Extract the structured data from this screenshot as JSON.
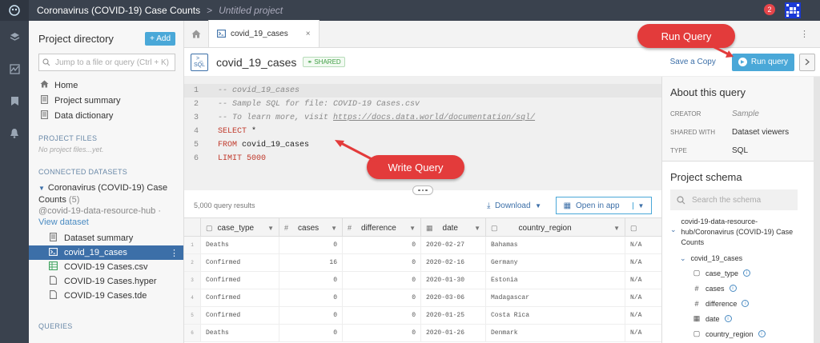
{
  "app": {
    "title": "Coronavirus (COVID-19) Case Counts",
    "separator": ">",
    "project_name": "Untitled project",
    "notification_count": "2"
  },
  "sidebar": {
    "title": "Project directory",
    "add_label": "+ Add",
    "search_placeholder": "Jump to a file or query (Ctrl + K)",
    "nav": [
      {
        "label": "Home",
        "icon": "home-icon"
      },
      {
        "label": "Project summary",
        "icon": "document-icon"
      },
      {
        "label": "Data dictionary",
        "icon": "document-icon"
      }
    ],
    "project_files_heading": "PROJECT FILES",
    "no_files": "No project files...yet.",
    "connected_heading": "CONNECTED DATASETS",
    "dataset": {
      "name": "Coronavirus (COVID-19) Case Counts",
      "count": "(5)",
      "owner": "@covid-19-data-resource-hub",
      "view": "View dataset",
      "sep": " · "
    },
    "files": [
      {
        "label": "Dataset summary",
        "icon": "document-icon",
        "active": false
      },
      {
        "label": "covid_19_cases",
        "icon": "sql-query-icon",
        "active": true
      },
      {
        "label": "COVID-19 Cases.csv",
        "icon": "spreadsheet-icon",
        "active": false
      },
      {
        "label": "COVID-19 Cases.hyper",
        "icon": "file-icon",
        "active": false
      },
      {
        "label": "COVID-19 Cases.tde",
        "icon": "file-icon",
        "active": false
      }
    ],
    "queries_heading": "QUERIES"
  },
  "tabs": {
    "open_tab": "covid_19_cases",
    "close": "×"
  },
  "query": {
    "title": "covid_19_cases",
    "shared_badge": "SHARED",
    "save_copy": "Save a Copy",
    "run_label": "Run query",
    "badge_top": ">_",
    "badge_bottom": "SQL"
  },
  "editor": {
    "lines": [
      {
        "n": "1",
        "type": "comment",
        "text": "-- covid_19_cases"
      },
      {
        "n": "2",
        "type": "comment",
        "text": "-- Sample SQL for file: COVID-19 Cases.csv"
      },
      {
        "n": "3",
        "type": "comment",
        "text": "-- To learn more, visit ",
        "link": "https://docs.data.world/documentation/sql/"
      },
      {
        "n": "4",
        "type": "code",
        "kw": "SELECT",
        "rest": " *"
      },
      {
        "n": "5",
        "type": "code",
        "kw": "FROM",
        "rest": " covid_19_cases"
      },
      {
        "n": "6",
        "type": "code",
        "kw": "LIMIT",
        "rest": " 5000"
      }
    ]
  },
  "results": {
    "count": "5,000 query results",
    "download": "Download",
    "open_in_app": "Open in app",
    "columns": [
      {
        "name": "case_type",
        "type": "T"
      },
      {
        "name": "cases",
        "type": "#"
      },
      {
        "name": "difference",
        "type": "#"
      },
      {
        "name": "date",
        "type": "cal"
      },
      {
        "name": "country_region",
        "type": "T"
      },
      {
        "name": "",
        "type": "T"
      }
    ],
    "rows": [
      {
        "n": "1",
        "cells": [
          "Deaths",
          "0",
          "0",
          "2020-02-27",
          "Bahamas",
          "N/A"
        ]
      },
      {
        "n": "2",
        "cells": [
          "Confirmed",
          "16",
          "0",
          "2020-02-16",
          "Germany",
          "N/A"
        ]
      },
      {
        "n": "3",
        "cells": [
          "Confirmed",
          "0",
          "0",
          "2020-01-30",
          "Estonia",
          "N/A"
        ]
      },
      {
        "n": "4",
        "cells": [
          "Confirmed",
          "0",
          "0",
          "2020-03-06",
          "Madagascar",
          "N/A"
        ]
      },
      {
        "n": "5",
        "cells": [
          "Confirmed",
          "0",
          "0",
          "2020-01-25",
          "Costa Rica",
          "N/A"
        ]
      },
      {
        "n": "6",
        "cells": [
          "Deaths",
          "0",
          "0",
          "2020-01-26",
          "Denmark",
          "N/A"
        ]
      }
    ]
  },
  "about": {
    "title": "About this query",
    "creator_k": "CREATOR",
    "creator_v": "Sample",
    "shared_k": "SHARED WITH",
    "shared_v": "Dataset viewers",
    "type_k": "TYPE",
    "type_v": "SQL"
  },
  "schema": {
    "title": "Project schema",
    "search_placeholder": "Search the schema",
    "dataset_path": "covid-19-data-resource-hub/Coronavirus (COVID-19) Case Counts",
    "table": "covid_19_cases",
    "columns": [
      {
        "name": "case_type",
        "type": "T"
      },
      {
        "name": "cases",
        "type": "#"
      },
      {
        "name": "difference",
        "type": "#"
      },
      {
        "name": "date",
        "type": "cal"
      },
      {
        "name": "country_region",
        "type": "T"
      }
    ]
  },
  "annotations": {
    "run": "Run Query",
    "write": "Write Query",
    "color": "#e33b3b"
  }
}
